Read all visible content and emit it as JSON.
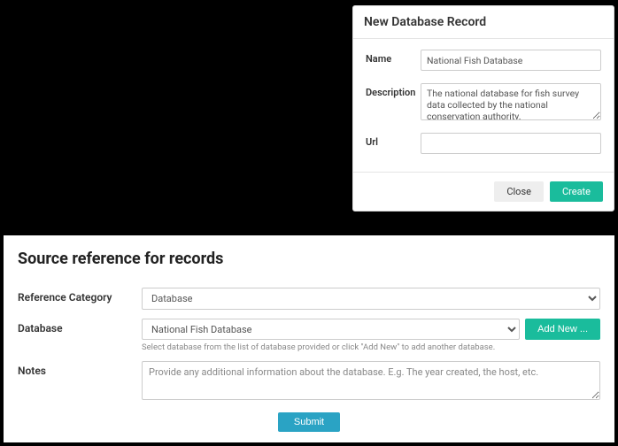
{
  "modal": {
    "title": "New Database Record",
    "name_label": "Name",
    "name_value": "National Fish Database",
    "desc_label": "Description",
    "desc_value": "The national database for fish survey data collected by the national conservation authority.",
    "url_label": "Url",
    "url_value": "",
    "close_label": "Close",
    "create_label": "Create"
  },
  "panel": {
    "title": "Source reference for records",
    "ref_cat_label": "Reference Category",
    "ref_cat_value": "Database",
    "db_label": "Database",
    "db_value": "National Fish Database",
    "db_helper": "Select database from the list of database provided or click \"Add New\" to add another database.",
    "addnew_label": "Add New ...",
    "notes_label": "Notes",
    "notes_placeholder": "Provide any additional information about the database. E.g. The year created, the host, etc.",
    "submit_label": "Submit"
  }
}
